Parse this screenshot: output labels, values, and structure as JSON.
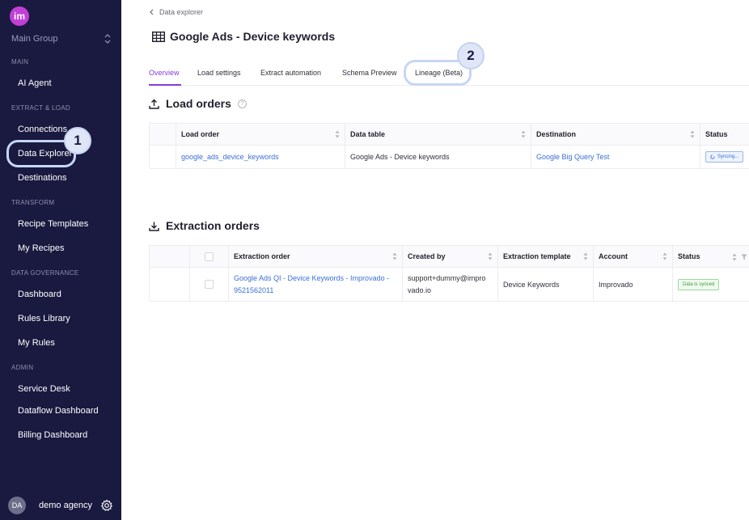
{
  "sidebar": {
    "logo": "im",
    "group": "Main Group",
    "sections": {
      "main": "MAIN",
      "extract": "EXTRACT & LOAD",
      "transform": "TRANSFORM",
      "governance": "DATA GOVERNANCE",
      "admin": "ADMIN"
    },
    "items": {
      "ai_agent": "AI Agent",
      "connections": "Connections",
      "data_explorer": "Data Explorer",
      "destinations": "Destinations",
      "recipe_templates": "Recipe Templates",
      "my_recipes": "My Recipes",
      "dashboard": "Dashboard",
      "rules_library": "Rules Library",
      "my_rules": "My Rules",
      "service_desk": "Service Desk",
      "dataflow_dashboard": "Dataflow Dashboard",
      "billing_dashboard": "Billing Dashboard"
    },
    "user": {
      "initials": "DA",
      "name": "demo agency"
    }
  },
  "callouts": {
    "one": "1",
    "two": "2"
  },
  "breadcrumb": "Data explorer",
  "page_title": "Google Ads - Device keywords",
  "tabs": [
    "Overview",
    "Load settings",
    "Extract automation",
    "Schema Preview",
    "Lineage (Beta)"
  ],
  "load_orders": {
    "title": "Load orders",
    "help": "?",
    "columns": [
      "Load order",
      "Data table",
      "Destination",
      "Status"
    ],
    "rows": [
      {
        "load_order": "google_ads_device_keywords",
        "data_table": "Google Ads - Device keywords",
        "destination": "Google Big Query Test",
        "status": "Syncing..."
      }
    ]
  },
  "extraction_orders": {
    "title": "Extraction orders",
    "columns": [
      "Extraction order",
      "Created by",
      "Extraction template",
      "Account",
      "Status"
    ],
    "rows": [
      {
        "order_line1": "Google Ads QI - Device Keywords - Improvado -",
        "order_line2": "9521562011",
        "created_line1": "support+dummy@impro",
        "created_line2": "vado.io",
        "template": "Device Keywords",
        "account": "Improvado",
        "status": "Data is synced"
      }
    ]
  },
  "colors": {
    "sidebar_bg": "#1a1940",
    "accent": "#8a3bd6",
    "link": "#3b6fd6",
    "logo": "#c23fd6"
  }
}
